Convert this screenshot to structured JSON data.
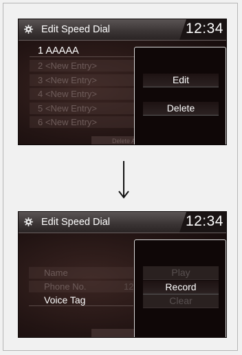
{
  "screen1": {
    "title": "Edit Speed Dial",
    "clock": "12:34",
    "list": [
      {
        "num": "1",
        "label": "AAAAA"
      },
      {
        "num": "2",
        "label": "<New Entry>"
      },
      {
        "num": "3",
        "label": "<New Entry>"
      },
      {
        "num": "4",
        "label": "<New Entry>"
      },
      {
        "num": "5",
        "label": "<New Entry>"
      },
      {
        "num": "6",
        "label": "<New Entry>"
      }
    ],
    "footer": "Delete A",
    "menu": [
      "Edit",
      "Delete"
    ]
  },
  "screen2": {
    "title": "Edit Speed Dial",
    "clock": "12:34",
    "fields": [
      "Name",
      "Phone No.",
      "Voice Tag"
    ],
    "phone_trail": "12",
    "menu": [
      "Play",
      "Record",
      "Clear"
    ]
  },
  "icons": {
    "settings": "gear-icon",
    "arrow": "down-arrow-icon"
  }
}
